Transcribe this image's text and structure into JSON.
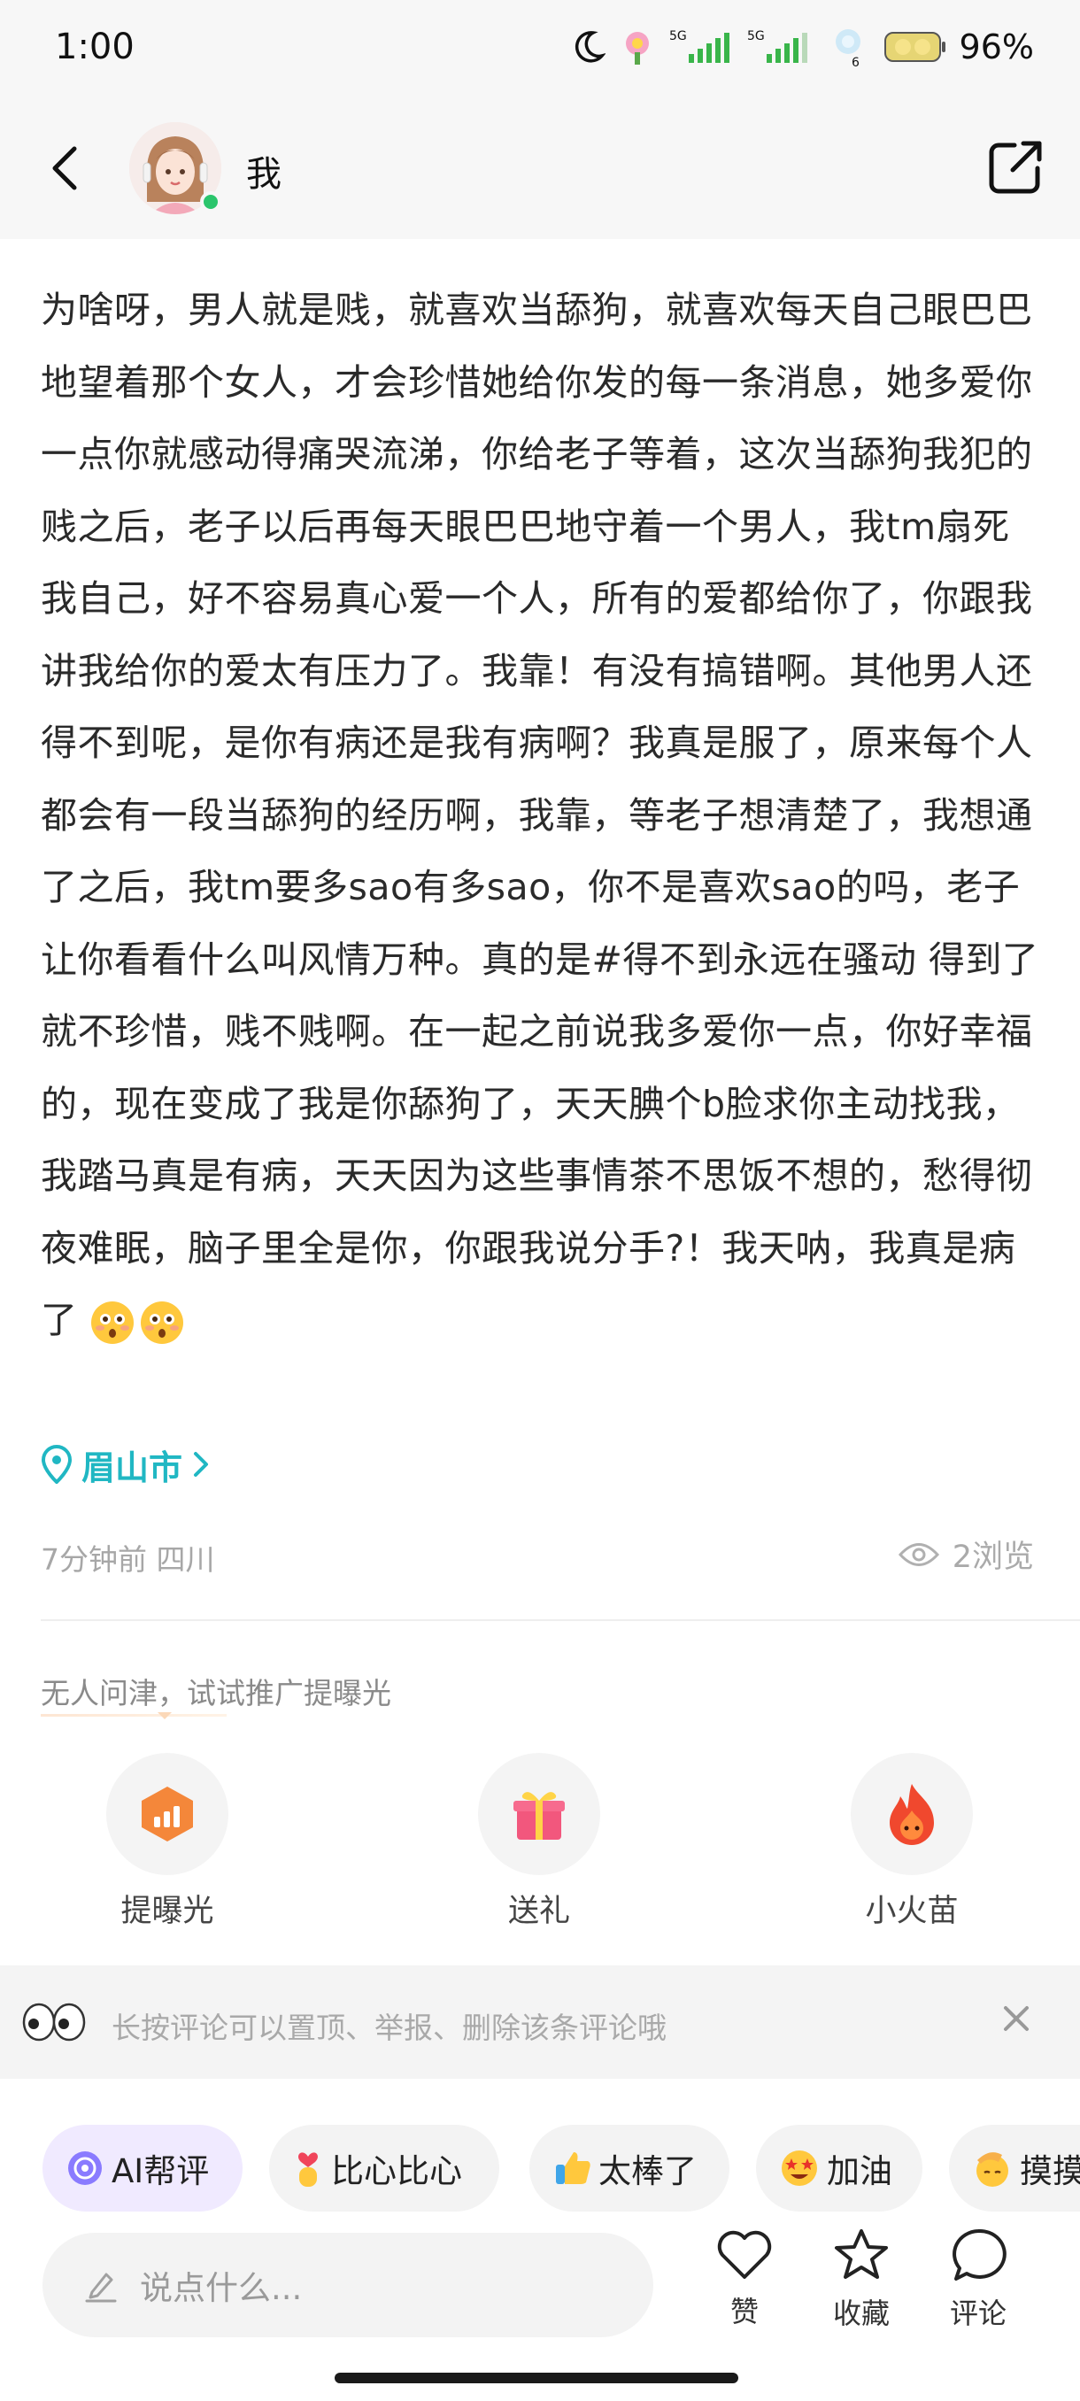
{
  "status_bar": {
    "time": "1:00",
    "battery": "96%",
    "icons": [
      "moon-icon",
      "app-icon",
      "signal-5g-icon",
      "signal-5g-icon",
      "wifi-icon",
      "battery-icon"
    ]
  },
  "header": {
    "name": "我",
    "icons": {
      "back": "back-chevron-icon",
      "share": "share-icon"
    }
  },
  "post": {
    "text": "为啥呀，男人就是贱，就喜欢当舔狗，就喜欢每天自己眼巴巴地望着那个女人，才会珍惜她给你发的每一条消息，她多爱你一点你就感动得痛哭流涕，你给老子等着，这次当舔狗我犯的贱之后，老子以后再每天眼巴巴地守着一个男人，我tm扇死我自己，好不容易真心爱一个人，所有的爱都给你了，你跟我讲我给你的爱太有压力了。我靠！有没有搞错啊。其他男人还得不到呢，是你有病还是我有病啊？我真是服了，原来每个人都会有一段当舔狗的经历啊，我靠，等老子想清楚了，我想通了之后，我tm要多sao有多sao，你不是喜欢sao的吗，老子让你看看什么叫风情万种。真的是#得不到永远在骚动 得到了就不珍惜，贱不贱啊。在一起之前说我多爱你一点，你好幸福的，现在变成了我是你舔狗了，天天腆个b脸求你主动找我，我踏马真是有病，天天因为这些事情茶不思饭不想的，愁得彻夜难眠，脑子里全是你，你跟我说分手?！我天呐，我真是病了",
    "emoji": [
      "flushed-face-emoji",
      "flushed-face-emoji"
    ],
    "location": "眉山市",
    "time_place": "7分钟前 四川",
    "views": "2浏览"
  },
  "promote": {
    "hint": "无人问津，试试推广提曝光",
    "actions": [
      {
        "label": "提曝光",
        "icon": "boost-icon"
      },
      {
        "label": "送礼",
        "icon": "gift-icon"
      },
      {
        "label": "小火苗",
        "icon": "flame-icon"
      }
    ]
  },
  "tip": {
    "text": "长按评论可以置顶、举报、删除该条评论哦"
  },
  "chips": [
    {
      "label": "AI帮评",
      "icon": "ai-icon"
    },
    {
      "label": "比心比心",
      "icon": "heart-hands-emoji"
    },
    {
      "label": "太棒了",
      "icon": "thumbs-up-emoji"
    },
    {
      "label": "加油",
      "icon": "star-eyes-emoji"
    },
    {
      "label": "摸摸",
      "icon": "pat-emoji"
    }
  ],
  "bottom_bar": {
    "placeholder": "说点什么...",
    "like": "赞",
    "favorite": "收藏",
    "comment": "评论"
  },
  "colors": {
    "accent_teal": "#20b7c3",
    "boost_orange": "#f4873a",
    "gift_pink": "#f2577d",
    "flame_red": "#f0482e"
  }
}
